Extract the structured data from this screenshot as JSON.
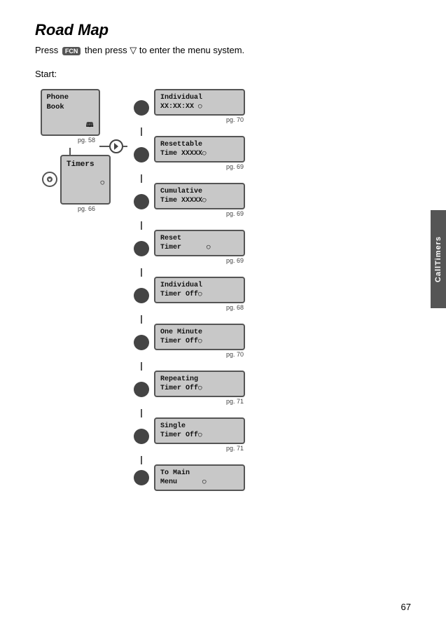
{
  "page": {
    "title": "Road Map",
    "intro": "Press  FCN  then press  ↓  to enter the menu system.",
    "start_label": "Start:",
    "page_number": "67",
    "side_tab": "CallTimers"
  },
  "diagram": {
    "phone_book": {
      "label": "Phone\nBook",
      "pg": "pg. 58"
    },
    "timers": {
      "label": "Timers",
      "pg": "pg. 66"
    },
    "menu_items": [
      {
        "label": "Individual\nXX:XX:XX",
        "pg": "pg. 70"
      },
      {
        "label": "Resettable\nTime XXXXX",
        "pg": "pg. 69"
      },
      {
        "label": "Cumulative\nTime XXXXX",
        "pg": "pg. 69"
      },
      {
        "label": "Reset\nTimer",
        "pg": "pg. 69"
      },
      {
        "label": "Individual\nTimer Off",
        "pg": "pg. 68"
      },
      {
        "label": "One Minute\nTimer Off",
        "pg": "pg. 70"
      },
      {
        "label": "Repeating\nTimer Off",
        "pg": "pg. 71"
      },
      {
        "label": "Single\nTimer Off",
        "pg": "pg. 71"
      },
      {
        "label": "To Main\nMenu",
        "pg": ""
      }
    ]
  }
}
